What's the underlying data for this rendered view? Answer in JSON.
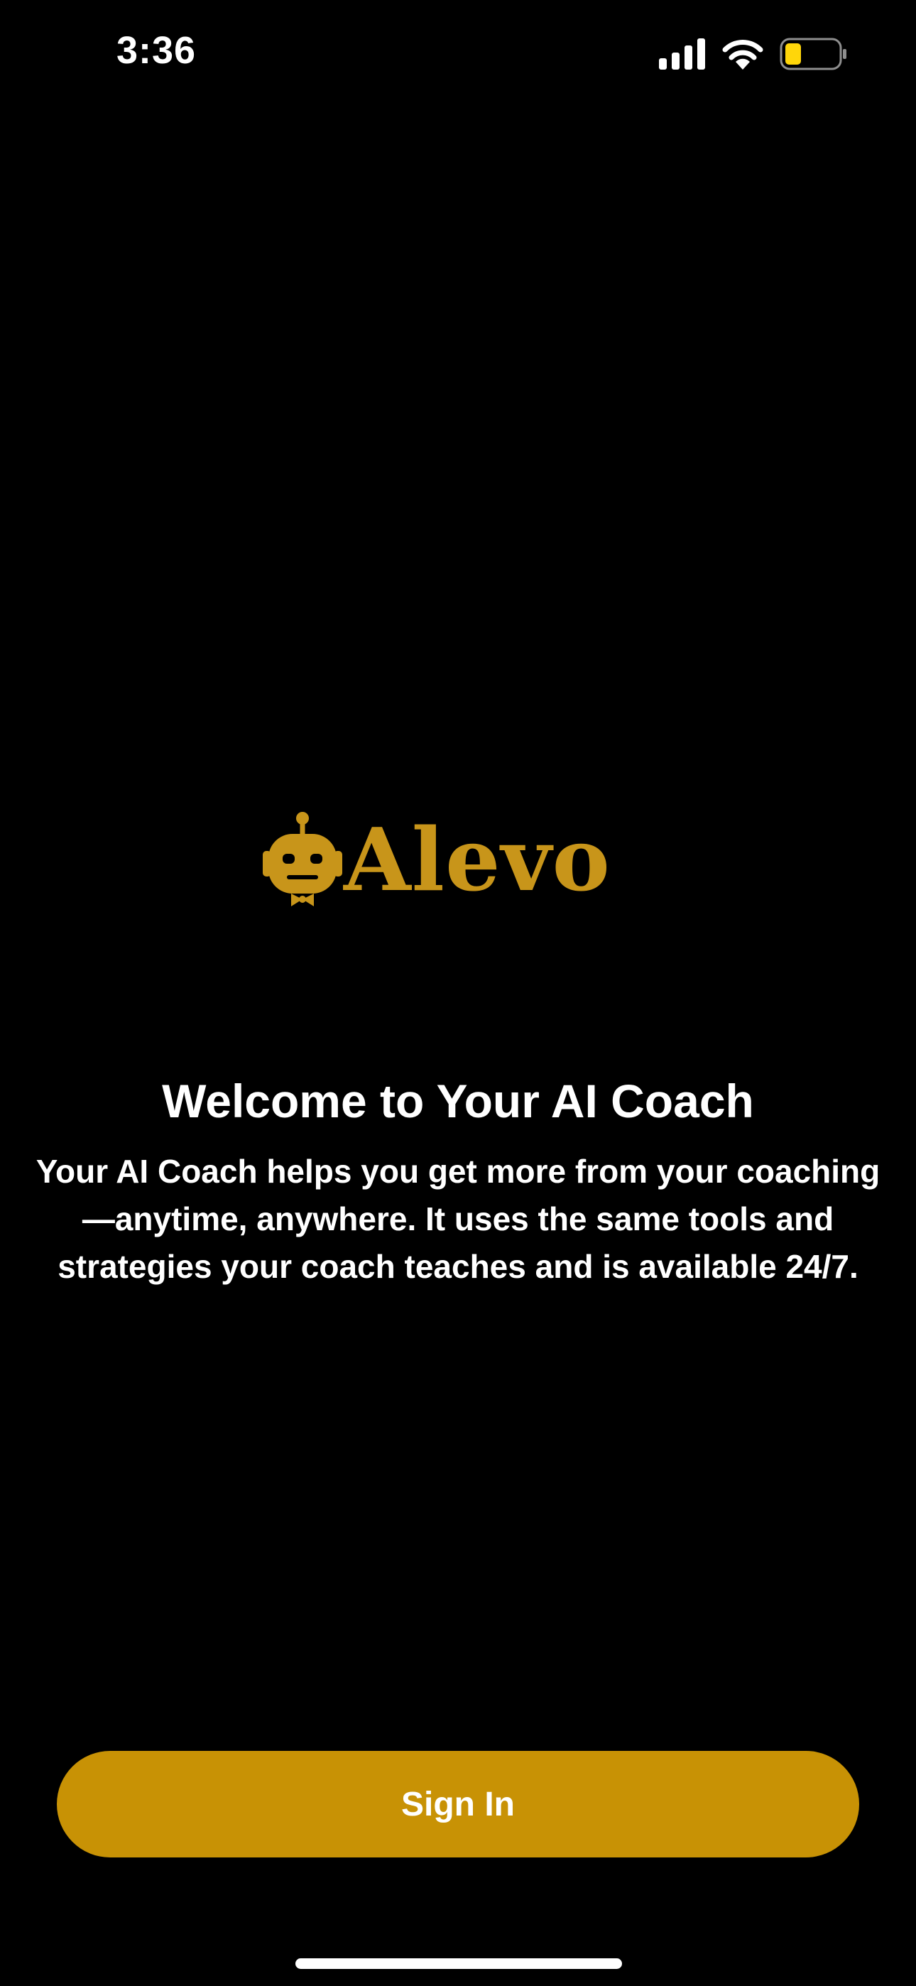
{
  "status_bar": {
    "time": "3:36",
    "icons": [
      "cellular-signal-icon",
      "wifi-icon",
      "battery-icon"
    ],
    "battery_level": 0.3,
    "battery_color": "#FFD60A"
  },
  "brand": {
    "name": "Alevo",
    "logo_icon": "robot-icon",
    "accent_color": "#C8951A"
  },
  "welcome": {
    "title": "Welcome to Your AI Coach",
    "body_lines": [
      "Your AI Coach helps you get more from your coaching",
      "—anytime, anywhere. It uses the same tools and",
      "strategies your coach teaches and is available 24/7."
    ]
  },
  "sign_in": {
    "label": "Sign In",
    "color": "#C89205"
  }
}
